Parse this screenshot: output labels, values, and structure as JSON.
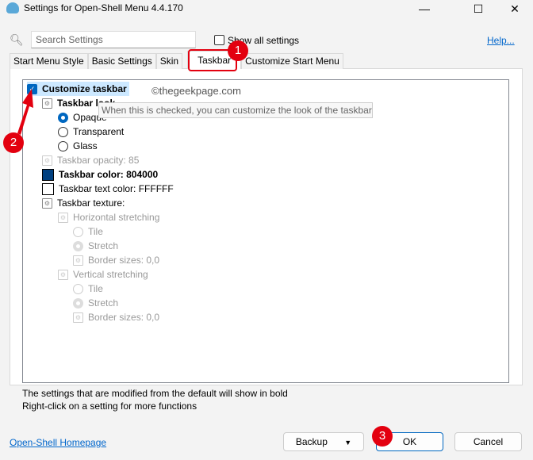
{
  "window": {
    "title": "Settings for Open-Shell Menu 4.4.170",
    "minimize": "—",
    "maximize": "☐",
    "close": "✕"
  },
  "search": {
    "placeholder": "Search Settings",
    "icon": "search-icon"
  },
  "show_all": {
    "label": "Show all settings",
    "checked": false
  },
  "help": "Help...",
  "tabs": [
    {
      "label": "Start Menu Style"
    },
    {
      "label": "Basic Settings"
    },
    {
      "label": "Skin"
    },
    {
      "label": "Taskbar",
      "active": true
    },
    {
      "label": "Customize Start Menu"
    }
  ],
  "tree": [
    {
      "type": "checkbox",
      "checked": true,
      "label": "Customize taskbar",
      "bold": true,
      "level": 0,
      "selected": true
    },
    {
      "type": "doc",
      "label": "Taskbar look",
      "bold": true,
      "level": 1
    },
    {
      "type": "radio",
      "checked": true,
      "label": "Opaque",
      "level": 2
    },
    {
      "type": "radio",
      "label": "Transparent",
      "level": 2
    },
    {
      "type": "radio",
      "label": "Glass",
      "level": 2
    },
    {
      "type": "doc",
      "label": "Taskbar opacity: 85",
      "level": 1,
      "disabled": true
    },
    {
      "type": "color",
      "color": "#004080",
      "label": "Taskbar color: 804000",
      "bold": true,
      "level": 1
    },
    {
      "type": "color",
      "color": "#FFFFFF",
      "label": "Taskbar text color: FFFFFF",
      "level": 1
    },
    {
      "type": "doc",
      "label": "Taskbar texture:",
      "level": 1
    },
    {
      "type": "doc",
      "label": "Horizontal stretching",
      "level": 2,
      "disabled": true
    },
    {
      "type": "radio",
      "label": "Tile",
      "level": 3,
      "disabled": true
    },
    {
      "type": "radio",
      "checked": true,
      "label": "Stretch",
      "level": 3,
      "disabled": true
    },
    {
      "type": "doc",
      "label": "Border sizes: 0,0",
      "level": 3,
      "disabled": true
    },
    {
      "type": "doc",
      "label": "Vertical stretching",
      "level": 2,
      "disabled": true
    },
    {
      "type": "radio",
      "label": "Tile",
      "level": 3,
      "disabled": true
    },
    {
      "type": "radio",
      "checked": true,
      "label": "Stretch",
      "level": 3,
      "disabled": true
    },
    {
      "type": "doc",
      "label": "Border sizes: 0,0",
      "level": 3,
      "disabled": true
    }
  ],
  "tooltip": "When this is checked, you can customize the look of the taskbar",
  "watermark": "©thegeekpage.com",
  "footer": {
    "line1": "The settings that are modified from the default will show in bold",
    "line2": "Right-click on a setting for more functions"
  },
  "homepage": "Open-Shell Homepage",
  "buttons": {
    "backup": "Backup",
    "backup_arrow": "▼",
    "ok": "OK",
    "cancel": "Cancel"
  },
  "badges": [
    "1",
    "2",
    "3"
  ],
  "accent": "#0067c0",
  "annotation_color": "#e3000f"
}
